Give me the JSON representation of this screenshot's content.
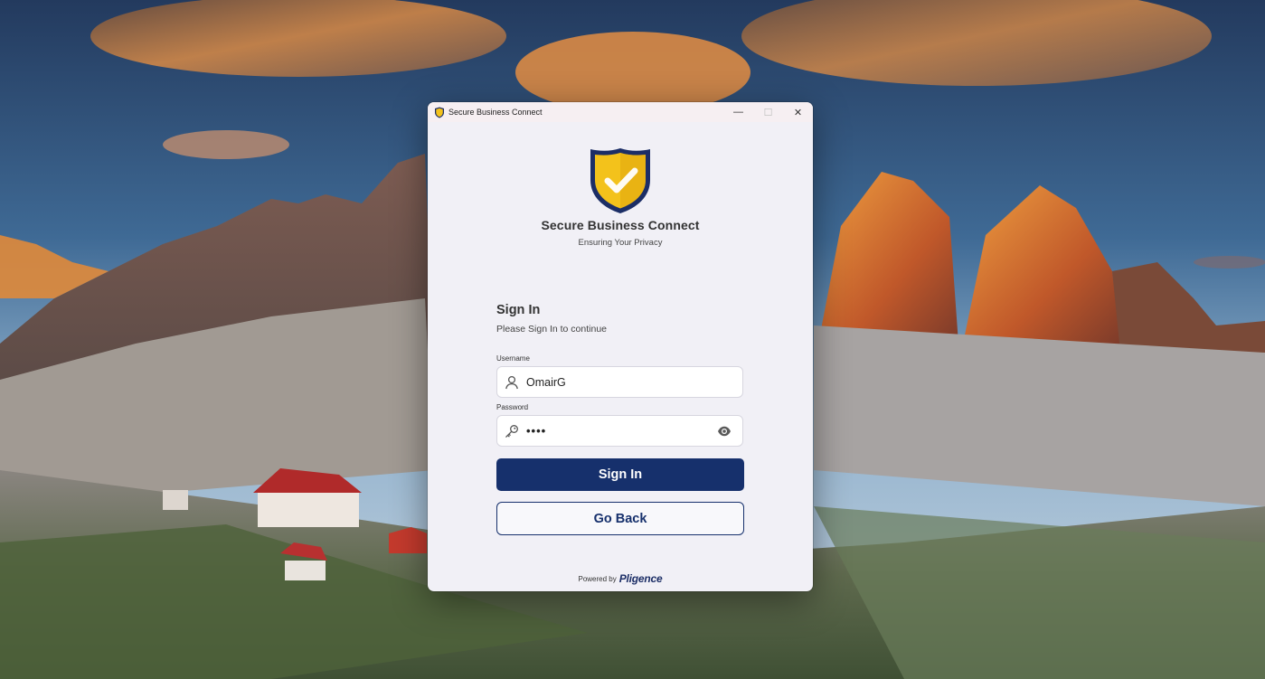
{
  "window": {
    "title": "Secure Business Connect",
    "controls": {
      "minimize": "—",
      "maximize": "☐",
      "close": "✕"
    }
  },
  "brand": {
    "name": "Secure Business Connect",
    "tagline": "Ensuring Your Privacy",
    "logo_icon": "shield-check-icon"
  },
  "signin": {
    "heading": "Sign In",
    "subtitle": "Please Sign In to continue",
    "username": {
      "label": "Username",
      "value": "OmairG",
      "icon": "user-icon"
    },
    "password": {
      "label": "Password",
      "masked_value": "••••",
      "icon": "key-icon",
      "reveal_icon": "eye-icon"
    },
    "submit_label": "Sign In",
    "back_label": "Go Back"
  },
  "footer": {
    "powered_by": "Powered by",
    "vendor": "Pligence"
  },
  "colors": {
    "primary": "#16306c",
    "window_bg": "#f1f0f6",
    "shield_gold": "#f3c21b",
    "shield_navy": "#1c2e66"
  }
}
